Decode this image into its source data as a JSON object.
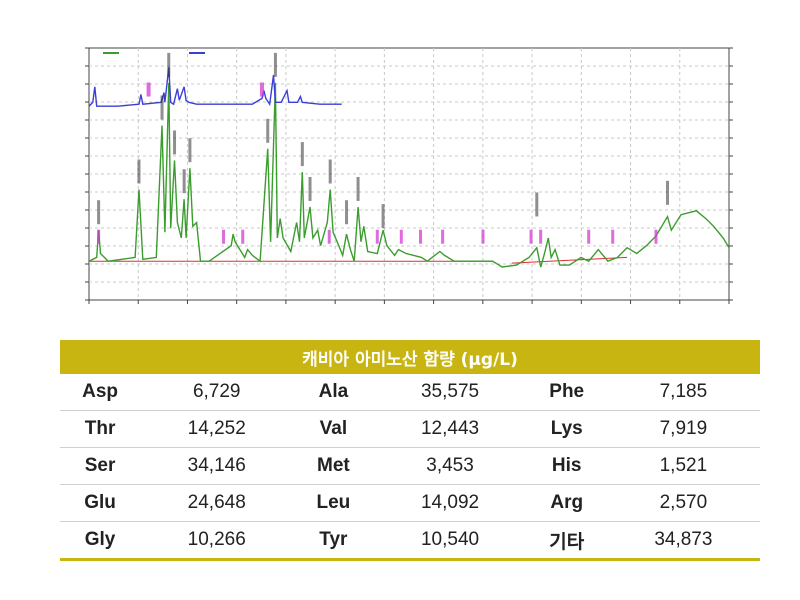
{
  "chart_data": {
    "type": "line",
    "series": [
      {
        "color": "#3a9d2d",
        "points": [
          [
            0,
            0
          ],
          [
            8,
            2
          ],
          [
            10,
            16
          ],
          [
            12,
            4
          ],
          [
            20,
            0
          ],
          [
            48,
            2
          ],
          [
            52,
            37
          ],
          [
            56,
            1
          ],
          [
            70,
            2
          ],
          [
            76,
            70
          ],
          [
            79,
            15
          ],
          [
            83,
            92
          ],
          [
            85,
            17
          ],
          [
            89,
            52
          ],
          [
            92,
            20
          ],
          [
            96,
            12
          ],
          [
            99,
            32
          ],
          [
            101,
            12
          ],
          [
            105,
            48
          ],
          [
            108,
            18
          ],
          [
            112,
            20
          ],
          [
            116,
            0
          ],
          [
            125,
            0
          ],
          [
            148,
            8
          ],
          [
            150,
            14
          ],
          [
            152,
            10
          ],
          [
            162,
            2
          ],
          [
            165,
            6
          ],
          [
            170,
            3
          ],
          [
            178,
            0
          ],
          [
            186,
            58
          ],
          [
            189,
            10
          ],
          [
            194,
            92
          ],
          [
            196,
            12
          ],
          [
            199,
            22
          ],
          [
            202,
            12
          ],
          [
            210,
            5
          ],
          [
            216,
            20
          ],
          [
            219,
            10
          ],
          [
            222,
            46
          ],
          [
            224,
            12
          ],
          [
            230,
            28
          ],
          [
            233,
            12
          ],
          [
            238,
            16
          ],
          [
            241,
            8
          ],
          [
            248,
            20
          ],
          [
            251,
            37
          ],
          [
            254,
            15
          ],
          [
            260,
            8
          ],
          [
            264,
            3
          ],
          [
            268,
            14
          ],
          [
            272,
            6
          ],
          [
            276,
            0
          ],
          [
            280,
            28
          ],
          [
            283,
            10
          ],
          [
            286,
            18
          ],
          [
            290,
            5
          ],
          [
            300,
            4
          ],
          [
            306,
            16
          ],
          [
            310,
            8
          ],
          [
            318,
            3
          ],
          [
            322,
            6
          ],
          [
            330,
            4
          ],
          [
            346,
            2
          ],
          [
            352,
            0
          ],
          [
            365,
            5
          ],
          [
            370,
            3
          ],
          [
            380,
            0
          ],
          [
            420,
            0
          ],
          [
            430,
            -3
          ],
          [
            445,
            -2
          ],
          [
            458,
            2
          ],
          [
            466,
            7
          ],
          [
            470,
            -3
          ],
          [
            474,
            4
          ],
          [
            478,
            12
          ],
          [
            481,
            2
          ],
          [
            485,
            6
          ],
          [
            490,
            -2
          ],
          [
            500,
            -2
          ],
          [
            512,
            2
          ],
          [
            520,
            0
          ],
          [
            530,
            6
          ],
          [
            540,
            0
          ],
          [
            550,
            2
          ],
          [
            560,
            7
          ],
          [
            570,
            4
          ],
          [
            580,
            8
          ],
          [
            590,
            13
          ],
          [
            596,
            18
          ],
          [
            602,
            23
          ],
          [
            606,
            16
          ],
          [
            616,
            24
          ],
          [
            632,
            26
          ],
          [
            642,
            22
          ],
          [
            650,
            18
          ],
          [
            660,
            12
          ],
          [
            666,
            7
          ]
        ]
      },
      {
        "color": "#3b3fd6",
        "points": [
          [
            0,
            80
          ],
          [
            4,
            82
          ],
          [
            6,
            90
          ],
          [
            8,
            80
          ],
          [
            30,
            80
          ],
          [
            52,
            81
          ],
          [
            54,
            86
          ],
          [
            56,
            81
          ],
          [
            75,
            82
          ],
          [
            78,
            87
          ],
          [
            79,
            82
          ],
          [
            83,
            100
          ],
          [
            85,
            82
          ],
          [
            88,
            81
          ],
          [
            92,
            89
          ],
          [
            94,
            83
          ],
          [
            99,
            90
          ],
          [
            101,
            83
          ],
          [
            104,
            82
          ],
          [
            112,
            81
          ],
          [
            170,
            81
          ],
          [
            180,
            84
          ],
          [
            182,
            88
          ],
          [
            184,
            84
          ],
          [
            188,
            81
          ],
          [
            192,
            96
          ],
          [
            194,
            82
          ],
          [
            200,
            82
          ],
          [
            206,
            88
          ],
          [
            208,
            82
          ],
          [
            217,
            82
          ],
          [
            220,
            85
          ],
          [
            222,
            82
          ],
          [
            240,
            81
          ],
          [
            263,
            81
          ]
        ]
      }
    ],
    "table": {
      "title": "캐비아 아미노산 함량 (µg/L)",
      "rows": [
        [
          {
            "name": "Asp",
            "value": "6,729"
          },
          {
            "name": "Ala",
            "value": "35,575"
          },
          {
            "name": "Phe",
            "value": "7,185"
          }
        ],
        [
          {
            "name": "Thr",
            "value": "14,252"
          },
          {
            "name": "Val",
            "value": "12,443"
          },
          {
            "name": "Lys",
            "value": "7,919"
          }
        ],
        [
          {
            "name": "Ser",
            "value": "34,146"
          },
          {
            "name": "Met",
            "value": "3,453"
          },
          {
            "name": "His",
            "value": "1,521"
          }
        ],
        [
          {
            "name": "Glu",
            "value": "24,648"
          },
          {
            "name": "Leu",
            "value": "14,092"
          },
          {
            "name": "Arg",
            "value": "2,570"
          }
        ],
        [
          {
            "name": "Gly",
            "value": "10,266"
          },
          {
            "name": "Tyr",
            "value": "10,540"
          },
          {
            "name": "기타",
            "value": "34,873"
          }
        ]
      ]
    }
  }
}
